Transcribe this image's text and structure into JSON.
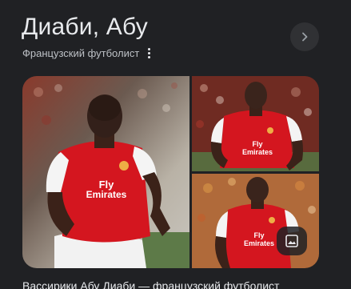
{
  "header": {
    "title": "Диаби, Абу",
    "subtitle": "Французский футболист"
  },
  "icons": {
    "more": "more-vert-icon",
    "next": "chevron-right-icon",
    "images": "image-icon"
  },
  "gallery": {
    "images": [
      {
        "id": "main",
        "kit_text": "Fly Emirates"
      },
      {
        "id": "top-right",
        "kit_text": "Fly Emirates"
      },
      {
        "id": "bottom-right",
        "kit_text": "Fly Emirates"
      }
    ]
  },
  "description": {
    "text": "Вассирики Абу Диаби — французский футболист"
  },
  "colors": {
    "background": "#202124",
    "text_primary": "#e8eaed",
    "text_secondary": "#bdc1c6",
    "button_bg": "#303134",
    "kit_red": "#d4161f"
  }
}
